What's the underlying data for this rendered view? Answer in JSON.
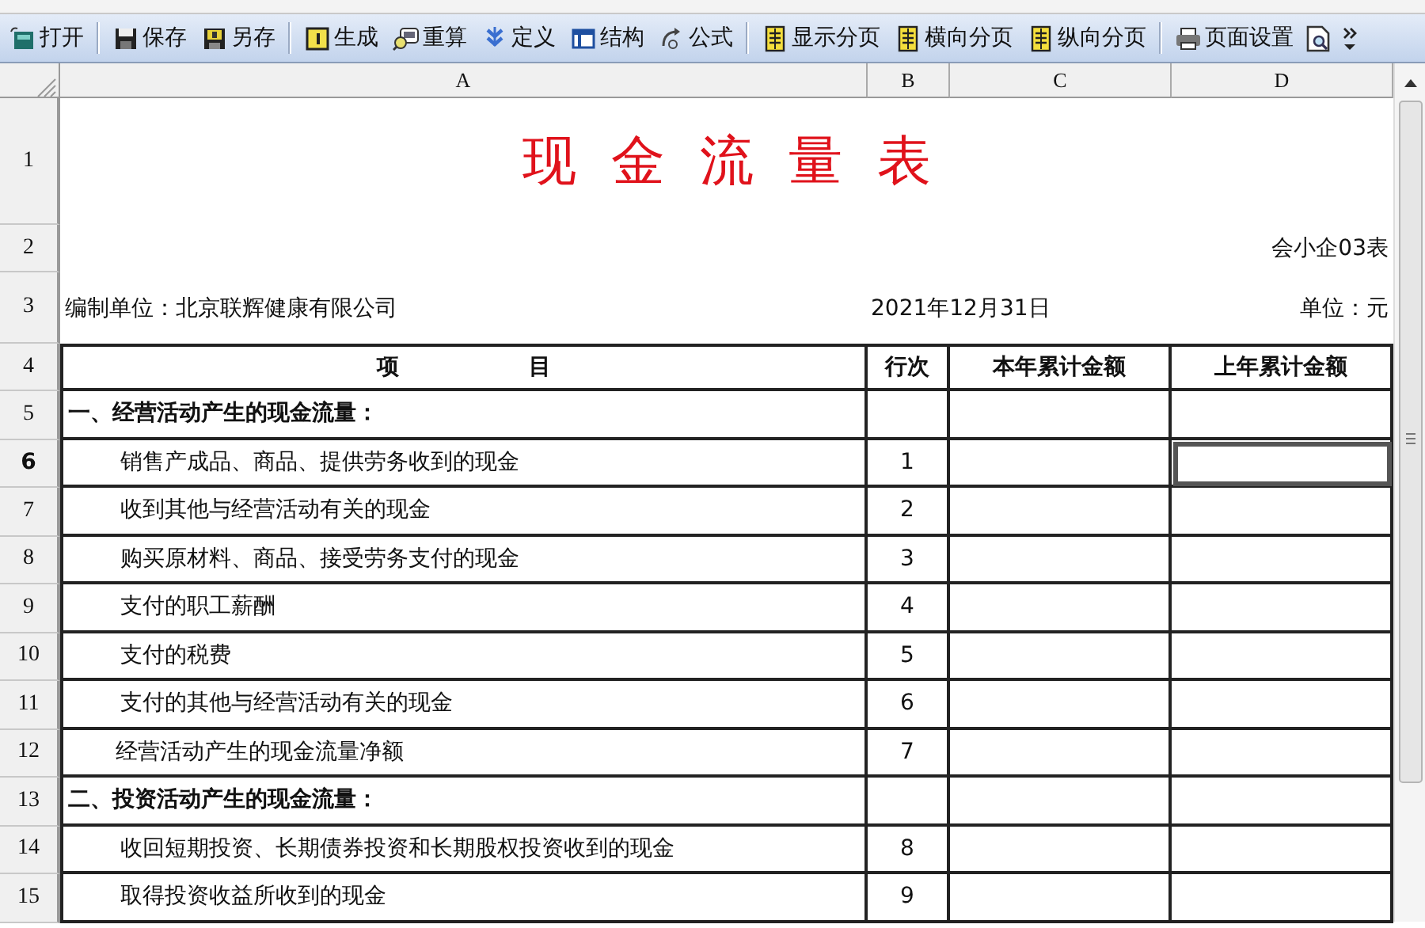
{
  "toolbar": [
    {
      "kind": "open",
      "label": "打开"
    },
    {
      "kind": "separator"
    },
    {
      "kind": "save",
      "label": "保存"
    },
    {
      "kind": "saveas",
      "label": "另存"
    },
    {
      "kind": "separator"
    },
    {
      "kind": "generate",
      "label": "生成"
    },
    {
      "kind": "recalc",
      "label": "重算"
    },
    {
      "kind": "define",
      "label": "定义"
    },
    {
      "kind": "structure",
      "label": "结构"
    },
    {
      "kind": "formula",
      "label": "公式"
    },
    {
      "kind": "separator"
    },
    {
      "kind": "page",
      "label": "显示分页"
    },
    {
      "kind": "page",
      "label": "横向分页"
    },
    {
      "kind": "page",
      "label": "纵向分页"
    },
    {
      "kind": "separator"
    },
    {
      "kind": "pagesetup",
      "label": "页面设置"
    },
    {
      "kind": "preview"
    },
    {
      "kind": "overflow"
    }
  ],
  "columns": [
    {
      "label": "A"
    },
    {
      "label": "B"
    },
    {
      "label": "C"
    },
    {
      "label": "D"
    }
  ],
  "rows": [
    {
      "number": "1",
      "selected": false,
      "kind": "title",
      "text": "现 金 流 量 表"
    },
    {
      "number": "2",
      "selected": false,
      "kind": "note",
      "text": "会小企03表"
    },
    {
      "number": "3",
      "selected": false,
      "kind": "info",
      "left": "编制单位：北京联辉健康有限公司",
      "middle": "2021年12月31日",
      "right": "单位：元"
    },
    {
      "number": "4",
      "selected": false,
      "kind": "header",
      "cells": [
        {
          "text": "项 目",
          "selected": false
        },
        {
          "text": "行次",
          "selected": false
        },
        {
          "text": "本年累计金额",
          "selected": false
        },
        {
          "text": "上年累计金额",
          "selected": false
        }
      ]
    },
    {
      "number": "5",
      "selected": false,
      "kind": "section",
      "cells": [
        {
          "text": "一、经营活动产生的现金流量：",
          "selected": false
        },
        {
          "selected": false
        },
        {
          "selected": false
        },
        {
          "selected": false
        }
      ]
    },
    {
      "number": "6",
      "selected": true,
      "kind": "item",
      "cells": [
        {
          "text": "销售产成品、商品、提供劳务收到的现金",
          "selected": false
        },
        {
          "text": "1",
          "selected": false
        },
        {
          "selected": false
        },
        {
          "selected": true
        }
      ]
    },
    {
      "number": "7",
      "selected": false,
      "kind": "item",
      "cells": [
        {
          "text": "收到其他与经营活动有关的现金",
          "selected": false
        },
        {
          "text": "2",
          "selected": false
        },
        {
          "selected": false
        },
        {
          "selected": false
        }
      ]
    },
    {
      "number": "8",
      "selected": false,
      "kind": "item",
      "cells": [
        {
          "text": "购买原材料、商品、接受劳务支付的现金",
          "selected": false
        },
        {
          "text": "3",
          "selected": false
        },
        {
          "selected": false
        },
        {
          "selected": false
        }
      ]
    },
    {
      "number": "9",
      "selected": false,
      "kind": "item",
      "cells": [
        {
          "text": "支付的职工薪酬",
          "selected": false
        },
        {
          "text": "4",
          "selected": false
        },
        {
          "selected": false
        },
        {
          "selected": false
        }
      ]
    },
    {
      "number": "10",
      "selected": false,
      "kind": "item",
      "cells": [
        {
          "text": "支付的税费",
          "selected": false
        },
        {
          "text": "5",
          "selected": false
        },
        {
          "selected": false
        },
        {
          "selected": false
        }
      ]
    },
    {
      "number": "11",
      "selected": false,
      "kind": "item",
      "cells": [
        {
          "text": "支付的其他与经营活动有关的现金",
          "selected": false
        },
        {
          "text": "6",
          "selected": false
        },
        {
          "selected": false
        },
        {
          "selected": false
        }
      ]
    },
    {
      "number": "12",
      "selected": false,
      "kind": "total",
      "cells": [
        {
          "text": "经营活动产生的现金流量净额",
          "selected": false
        },
        {
          "text": "7",
          "selected": false
        },
        {
          "selected": false
        },
        {
          "selected": false
        }
      ]
    },
    {
      "number": "13",
      "selected": false,
      "kind": "section",
      "cells": [
        {
          "text": "二、投资活动产生的现金流量：",
          "selected": false
        },
        {
          "selected": false
        },
        {
          "selected": false
        },
        {
          "selected": false
        }
      ]
    },
    {
      "number": "14",
      "selected": false,
      "kind": "item",
      "cells": [
        {
          "text": "收回短期投资、长期债券投资和长期股权投资收到的现金",
          "selected": false
        },
        {
          "text": "8",
          "selected": false
        },
        {
          "selected": false
        },
        {
          "selected": false
        }
      ]
    },
    {
      "number": "15",
      "selected": false,
      "kind": "item",
      "cells": [
        {
          "text": "取得投资收益所收到的现金",
          "selected": false
        },
        {
          "text": "9",
          "selected": false
        },
        {
          "selected": false
        },
        {
          "selected": false
        }
      ]
    }
  ]
}
